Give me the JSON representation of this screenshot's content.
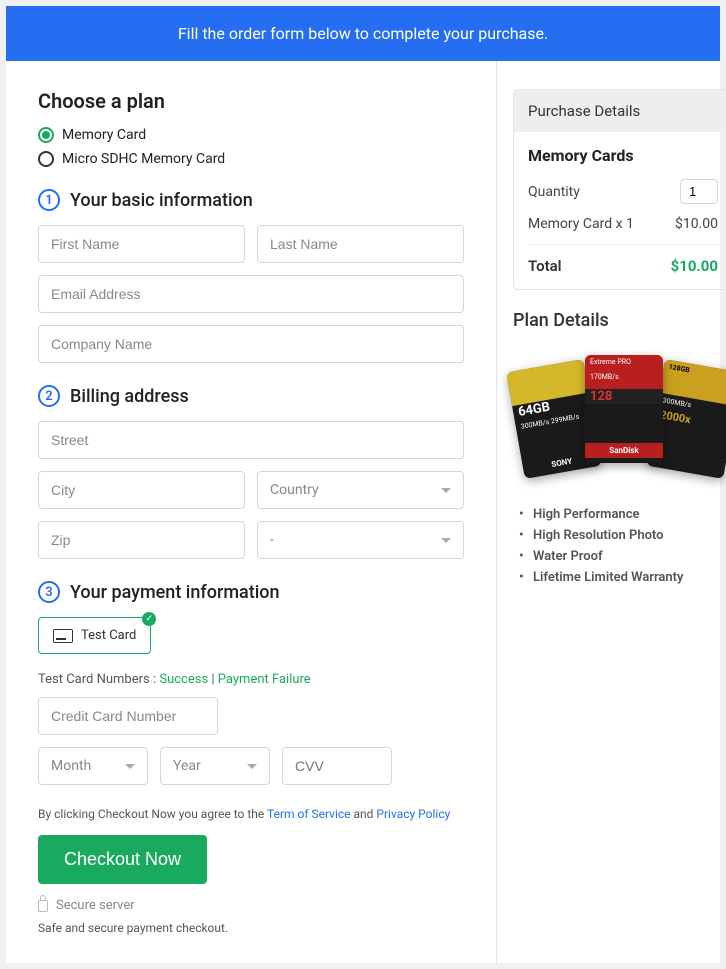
{
  "banner": "Fill the order form below to complete your purchase.",
  "plan": {
    "heading": "Choose a plan",
    "option1": "Memory Card",
    "option2": "Micro SDHC Memory Card"
  },
  "step1": {
    "num": "1",
    "title": "Your basic information"
  },
  "step2": {
    "num": "2",
    "title": "Billing address"
  },
  "step3": {
    "num": "3",
    "title": "Your payment information"
  },
  "fields": {
    "first": "First Name",
    "last": "Last Name",
    "email": "Email Address",
    "company": "Company Name",
    "street": "Street",
    "city": "City",
    "country": "Country",
    "zip": "Zip",
    "state": "-",
    "testCard": "Test Card",
    "testLine1": "Test Card Numbers : ",
    "success": "Success",
    "sep": " | ",
    "failure": "Payment Failure",
    "ccnum": "Credit Card Number",
    "month": "Month",
    "year": "Year",
    "cvv": "CVV"
  },
  "agree": {
    "t1": "By clicking Checkout Now you agree to the ",
    "tos": "Term of Service",
    "and": " and ",
    "pp": "Privacy Policy"
  },
  "checkout": "Checkout Now",
  "secure1": "Secure server",
  "secure2": "Safe and secure payment checkout.",
  "purchase": {
    "head": "Purchase Details",
    "title": "Memory Cards",
    "qtyLabel": "Quantity",
    "qty": "1",
    "line": "Memory Card x 1",
    "price": "$10.00",
    "totalLabel": "Total",
    "total": "$10.00"
  },
  "planDetails": {
    "head": "Plan Details",
    "features": [
      "High Performance",
      "High Resolution Photo",
      "Water Proof",
      "Lifetime Limited Warranty"
    ]
  },
  "sd": {
    "c1a": "64GB",
    "c1b": "300MB/s 299MB/s",
    "c1brand": "SONY",
    "c2a": "Extreme PRO",
    "c2b": "170MB/s",
    "c2big": "128",
    "c2brand": "SanDisk",
    "c3a": "128GB",
    "c3b": "300MB/s",
    "c3big": "2000x"
  }
}
